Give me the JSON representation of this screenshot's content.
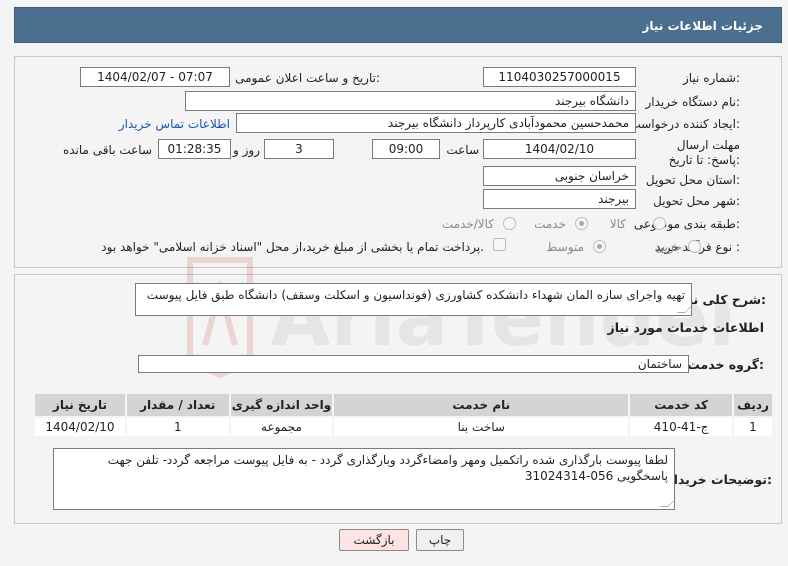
{
  "header": {
    "title": "جزئیات اطلاعات نیاز"
  },
  "form": {
    "need_number_label": "شماره نیاز:",
    "need_number": "1104030257000015",
    "announce_label": "تاریخ و ساعت اعلان عمومی:",
    "announce_value": "1404/02/07 - 07:07",
    "buyer_org_label": "نام دستگاه خریدار:",
    "buyer_org": "دانشگاه بیرجند",
    "requester_label": "ایجاد کننده درخواست:",
    "requester": "محمدحسین محمودآبادی کارپرداز دانشگاه بیرجند",
    "contact_link": "اطلاعات تماس خریدار",
    "deadline_label": "مهلت ارسال پاسخ: تا تاریخ:",
    "deadline_date": "1404/02/10",
    "time_label": "ساعت",
    "deadline_time": "09:00",
    "days_value": "3",
    "days_label": "روز و",
    "remaining_time": "01:28:35",
    "remaining_label": "ساعت باقی مانده",
    "province_label": "استان محل تحویل:",
    "province": "خراسان جنوبی",
    "city_label": "شهر محل تحویل:",
    "city": "بیرجند",
    "category_label": "طبقه بندی موضوعی:",
    "category_options": [
      "کالا",
      "خدمت",
      "کالا/خدمت"
    ],
    "process_label": "نوع فرآیند خرید :",
    "process_options": [
      "جزیی",
      "متوسط"
    ],
    "payment_note": "پرداخت تمام یا بخشی از مبلغ خرید،از محل \"اسناد خزانه اسلامی\" خواهد بود."
  },
  "general": {
    "desc_label": "شرح کلی نیاز:",
    "desc_value": "تهیه واجرای سازه المان شهداء دانشکده کشاورزی (فونداسیون و اسکلت وسقف) دانشگاه طبق فایل پیوست",
    "services_title": "اطلاعات خدمات مورد نیاز",
    "service_group_label": "گروه خدمت:",
    "service_group": "ساختمان"
  },
  "table": {
    "headers": [
      "ردیف",
      "کد خدمت",
      "نام خدمت",
      "واحد اندازه گیری",
      "تعداد / مقدار",
      "تاریخ نیاز"
    ],
    "rows": [
      [
        "1",
        "ج-41-410",
        "ساخت بنا",
        "مجموعه",
        "1",
        "1404/02/10"
      ]
    ]
  },
  "buyer_notes": {
    "label": "توضیحات خریدار:",
    "value": "لطفا پیوست بارگذاری شده راتکمیل ومهر وامضاءگردد وبارگذاری گردد - به فایل پیوست مراجعه گردد- تلفن جهت پاسخگویی 056-31024314"
  },
  "buttons": {
    "print": "چاپ",
    "back": "بازگشت"
  },
  "watermark": {
    "text": "AriaTender.net"
  },
  "colors": {
    "header_bg": "#4a6f8f",
    "link": "#1a56b0",
    "back_button_bg": "#fde4e4"
  }
}
